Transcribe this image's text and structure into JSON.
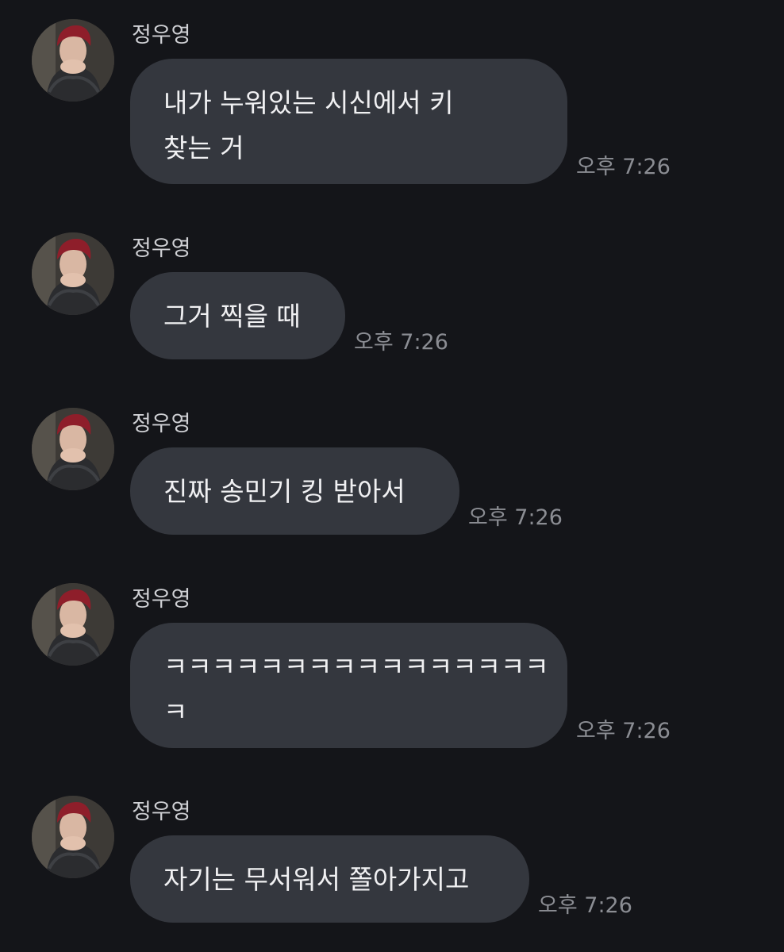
{
  "messages": [
    {
      "sender": "정우영",
      "lines": [
        "내가 누워있는 시신에서 키",
        "찾는 거"
      ],
      "time": "오후 7:26"
    },
    {
      "sender": "정우영",
      "lines": [
        "그거 찍을 때"
      ],
      "time": "오후 7:26"
    },
    {
      "sender": "정우영",
      "lines": [
        "진짜 송민기 킹 받아서"
      ],
      "time": "오후 7:26"
    },
    {
      "sender": "정우영",
      "lines": [
        "ㅋㅋㅋㅋㅋㅋㅋㅋㅋㅋㅋㅋㅋㅋㅋㅋ",
        "ㅋ"
      ],
      "time": "오후 7:26"
    },
    {
      "sender": "정우영",
      "lines": [
        "자기는 무서워서 쫄아가지고"
      ],
      "time": "오후 7:26"
    }
  ],
  "colors": {
    "background": "#141519",
    "bubble": "#34373e",
    "sender_text": "#cfd0d4",
    "message_text": "#f0f0f2",
    "timestamp": "#8b8d93"
  },
  "icons": {
    "avatar": "profile-photo-icon"
  }
}
